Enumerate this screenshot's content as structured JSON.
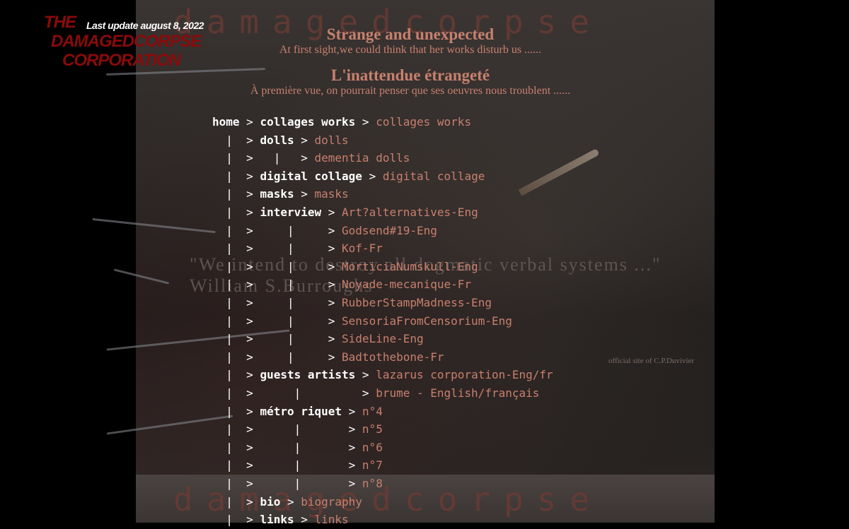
{
  "brand": {
    "logo_lines": [
      "THE",
      "DAMAGEDCORPSE",
      "CORPORATION"
    ],
    "last_update": "Last update  august 8, 2022",
    "banner_text": "damagedcorpse"
  },
  "headings": {
    "en_title": "Strange and unexpected",
    "en_subtitle": "At first sight,we could think that her works disturb us ......",
    "fr_title": "L'inattendue étrangeté",
    "fr_subtitle": "À première vue, on pourrait penser que ses oeuvres nous troublent ......"
  },
  "background_text": {
    "quote": "\"We intend to destroy all dogmatic verbal systems ...\"",
    "author": "William S.Burroughs",
    "credit": "official site of C.P.Duvivier"
  },
  "nav": {
    "rows": [
      {
        "prefix": "",
        "label": "home",
        "sep": " > ",
        "label2": "collages works",
        "sep2": " > ",
        "link": "collages works"
      },
      {
        "prefix": "  |  > ",
        "label": "dolls",
        "sep": " > ",
        "link": "dolls"
      },
      {
        "prefix": "  |  >   |   > ",
        "link": "dementia dolls"
      },
      {
        "prefix": "  |  > ",
        "label": "digital collage",
        "sep": " > ",
        "link": "digital collage"
      },
      {
        "prefix": "  |  > ",
        "label": "masks",
        "sep": " > ",
        "link": "masks"
      },
      {
        "prefix": "  |  > ",
        "label": "interview",
        "sep": " > ",
        "link": "Art?alternatives-Eng"
      },
      {
        "prefix": "  |  >     |     > ",
        "link": "Godsend#19-Eng"
      },
      {
        "prefix": "  |  >     |     > ",
        "link": "Kof-Fr"
      },
      {
        "prefix": "  |  >     |     > ",
        "link": "MorticiaNumskull-Eng"
      },
      {
        "prefix": "  |  >     |     > ",
        "link": "Noyade-mecanique-Fr"
      },
      {
        "prefix": "  |  >     |     > ",
        "link": "RubberStampMadness-Eng"
      },
      {
        "prefix": "  |  >     |     > ",
        "link": "SensoriaFromCensorium-Eng"
      },
      {
        "prefix": "  |  >     |     > ",
        "link": "SideLine-Eng"
      },
      {
        "prefix": "  |  >     |     > ",
        "link": "Badtothebone-Fr"
      },
      {
        "prefix": "  |  > ",
        "label": "guests artists",
        "sep": " > ",
        "link": "lazarus corporation-Eng/fr"
      },
      {
        "prefix": "  |  >      |         > ",
        "link": "brume - English/français"
      },
      {
        "prefix": "  |  > ",
        "label": "métro riquet",
        "sep": " > ",
        "link": "n°4"
      },
      {
        "prefix": "  |  >      |       > ",
        "link": "n°5"
      },
      {
        "prefix": "  |  >      |       > ",
        "link": "n°6"
      },
      {
        "prefix": "  |  >      |       > ",
        "link": "n°7"
      },
      {
        "prefix": "  |  >      |       > ",
        "link": "n°8"
      },
      {
        "prefix": "  |  > ",
        "label": "bio",
        "sep": " > ",
        "link": "biography"
      },
      {
        "prefix": "  |  > ",
        "label": "links",
        "sep": " > ",
        "link": "links"
      }
    ]
  }
}
